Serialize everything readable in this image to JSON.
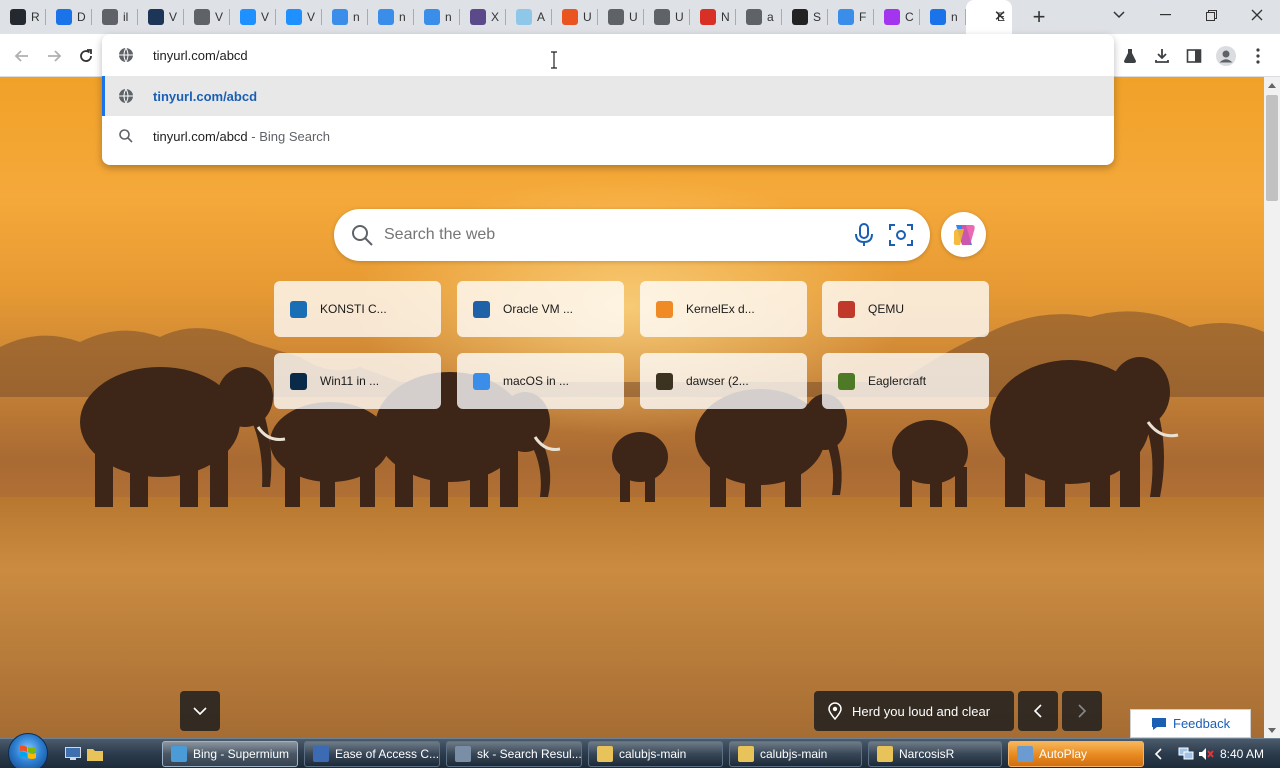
{
  "browser": {
    "tabs": [
      {
        "title": "R",
        "icon": "github-icon",
        "color": "#24292f"
      },
      {
        "title": "D",
        "icon": "download-icon",
        "color": "#1a73e8"
      },
      {
        "title": "il",
        "icon": "globe-icon",
        "color": "#5f6368"
      },
      {
        "title": "V",
        "icon": "virtualbox-icon",
        "color": "#1d3557"
      },
      {
        "title": "V",
        "icon": "globe-icon",
        "color": "#5f6368"
      },
      {
        "title": "V",
        "icon": "windows-icon",
        "color": "#1e90ff"
      },
      {
        "title": "V",
        "icon": "windows-icon",
        "color": "#1e90ff"
      },
      {
        "title": "n",
        "icon": "finder-icon",
        "color": "#3a8eea"
      },
      {
        "title": "n",
        "icon": "finder-icon",
        "color": "#3a8eea"
      },
      {
        "title": "n",
        "icon": "finder-icon",
        "color": "#3a8eea"
      },
      {
        "title": "X",
        "icon": "cat-icon",
        "color": "#5b4a8a"
      },
      {
        "title": "A",
        "icon": "snowflake-icon",
        "color": "#8fc7e8"
      },
      {
        "title": "U",
        "icon": "ubuntu-icon",
        "color": "#e95420"
      },
      {
        "title": "U",
        "icon": "globe-icon",
        "color": "#5f6368"
      },
      {
        "title": "U",
        "icon": "globe-icon",
        "color": "#5f6368"
      },
      {
        "title": "N",
        "icon": "target-icon",
        "color": "#d93025"
      },
      {
        "title": "a",
        "icon": "globe-icon",
        "color": "#5f6368"
      },
      {
        "title": "S",
        "icon": "feather-icon",
        "color": "#222222"
      },
      {
        "title": "F",
        "icon": "finder-icon",
        "color": "#3a8eea"
      },
      {
        "title": "C",
        "icon": "gradient-app-icon",
        "color": "#a335ee"
      },
      {
        "title": "n",
        "icon": "search-icon",
        "color": "#1a73e8"
      },
      {
        "title": "E",
        "icon": "blank-icon",
        "color": "#ffffff"
      }
    ],
    "active_tab_index": 21,
    "omnibox": {
      "value": "tinyurl.com/abcd",
      "suggestions": [
        {
          "text": "tinyurl.com/abcd",
          "sub": "",
          "icon": "globe-icon",
          "selected": true
        },
        {
          "text": "tinyurl.com/abcd",
          "sub": " - Bing Search",
          "icon": "search-icon",
          "selected": false
        }
      ]
    }
  },
  "page": {
    "search_placeholder": "Search the web",
    "tiles": [
      {
        "label": "KONSTI C...",
        "icon": "konsti-icon",
        "color": "#1a6fb4"
      },
      {
        "label": "Oracle VM ...",
        "icon": "virtualbox-icon",
        "color": "#2062a8"
      },
      {
        "label": "KernelEx d...",
        "icon": "kernelex-icon",
        "color": "#f08a24"
      },
      {
        "label": "QEMU",
        "icon": "qemu-icon",
        "color": "#c0392b"
      },
      {
        "label": "Win11 in ...",
        "icon": "win11-icon",
        "color": "#0a2a4a"
      },
      {
        "label": "macOS in ...",
        "icon": "finder-icon",
        "color": "#3a8eea"
      },
      {
        "label": "dawser (2...",
        "icon": "dawser-icon",
        "color": "#3b3320"
      },
      {
        "label": "Eaglercraft",
        "icon": "minecraft-icon",
        "color": "#4e7a27"
      }
    ],
    "image_caption": "Herd you loud and clear",
    "feedback_label": "Feedback"
  },
  "taskbar": {
    "tasks": [
      {
        "label": "Bing - Supermium",
        "icon": "supermium-icon",
        "color": "#4a9bd6",
        "state": "active"
      },
      {
        "label": "Ease of Access C...",
        "icon": "ease-of-access-icon",
        "color": "#3d6bb3",
        "state": "normal"
      },
      {
        "label": "sk - Search Resul...",
        "icon": "search-folder-icon",
        "color": "#7a8ea6",
        "state": "normal"
      },
      {
        "label": "calubjs-main",
        "icon": "folder-icon",
        "color": "#e8c35a",
        "state": "normal"
      },
      {
        "label": "calubjs-main",
        "icon": "folder-icon",
        "color": "#e8c35a",
        "state": "normal"
      },
      {
        "label": "NarcosisR",
        "icon": "folder-icon",
        "color": "#e8c35a",
        "state": "normal"
      },
      {
        "label": "AutoPlay",
        "icon": "autoplay-icon",
        "color": "#6c9bd2",
        "state": "flash"
      }
    ],
    "clock": "8:40 AM"
  }
}
